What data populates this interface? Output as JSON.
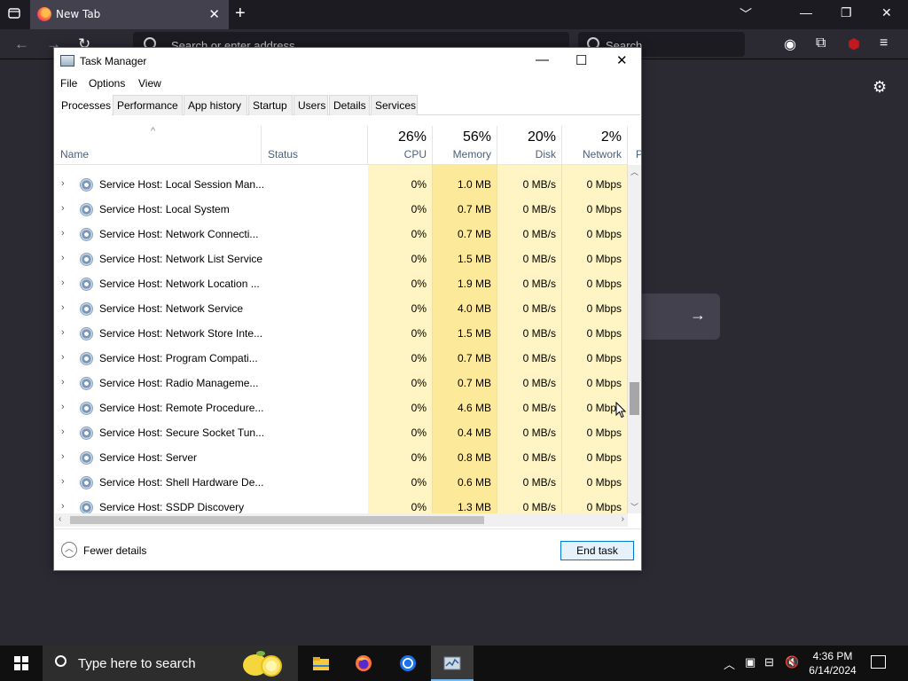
{
  "browser": {
    "tab_title": "New Tab",
    "url_placeholder": "Search or enter address",
    "search_placeholder": "Search"
  },
  "taskmgr": {
    "title": "Task Manager",
    "menu": [
      "File",
      "Options",
      "View"
    ],
    "tabs": [
      "Processes",
      "Performance",
      "App history",
      "Startup",
      "Users",
      "Details",
      "Services"
    ],
    "active_tab": "Processes",
    "columns": {
      "name": "Name",
      "status": "Status",
      "cpu": {
        "pct": "26%",
        "label": "CPU"
      },
      "memory": {
        "pct": "56%",
        "label": "Memory"
      },
      "disk": {
        "pct": "20%",
        "label": "Disk"
      },
      "network": {
        "pct": "2%",
        "label": "Network"
      },
      "power_partial": "P"
    },
    "rows": [
      {
        "name": "Service Host: Local Session Man...",
        "cpu": "0%",
        "memory": "1.0 MB",
        "disk": "0 MB/s",
        "network": "0 Mbps"
      },
      {
        "name": "Service Host: Local System",
        "cpu": "0%",
        "memory": "0.7 MB",
        "disk": "0 MB/s",
        "network": "0 Mbps"
      },
      {
        "name": "Service Host: Network Connecti...",
        "cpu": "0%",
        "memory": "0.7 MB",
        "disk": "0 MB/s",
        "network": "0 Mbps"
      },
      {
        "name": "Service Host: Network List Service",
        "cpu": "0%",
        "memory": "1.5 MB",
        "disk": "0 MB/s",
        "network": "0 Mbps"
      },
      {
        "name": "Service Host: Network Location ...",
        "cpu": "0%",
        "memory": "1.9 MB",
        "disk": "0 MB/s",
        "network": "0 Mbps"
      },
      {
        "name": "Service Host: Network Service",
        "cpu": "0%",
        "memory": "4.0 MB",
        "disk": "0 MB/s",
        "network": "0 Mbps"
      },
      {
        "name": "Service Host: Network Store Inte...",
        "cpu": "0%",
        "memory": "1.5 MB",
        "disk": "0 MB/s",
        "network": "0 Mbps"
      },
      {
        "name": "Service Host: Program Compati...",
        "cpu": "0%",
        "memory": "0.7 MB",
        "disk": "0 MB/s",
        "network": "0 Mbps"
      },
      {
        "name": "Service Host: Radio Manageme...",
        "cpu": "0%",
        "memory": "0.7 MB",
        "disk": "0 MB/s",
        "network": "0 Mbps"
      },
      {
        "name": "Service Host: Remote Procedure...",
        "cpu": "0%",
        "memory": "4.6 MB",
        "disk": "0 MB/s",
        "network": "0 Mbps"
      },
      {
        "name": "Service Host: Secure Socket Tun...",
        "cpu": "0%",
        "memory": "0.4 MB",
        "disk": "0 MB/s",
        "network": "0 Mbps"
      },
      {
        "name": "Service Host: Server",
        "cpu": "0%",
        "memory": "0.8 MB",
        "disk": "0 MB/s",
        "network": "0 Mbps"
      },
      {
        "name": "Service Host: Shell Hardware De...",
        "cpu": "0%",
        "memory": "0.6 MB",
        "disk": "0 MB/s",
        "network": "0 Mbps"
      },
      {
        "name": "Service Host: SSDP Discovery",
        "cpu": "0%",
        "memory": "1.3 MB",
        "disk": "0 MB/s",
        "network": "0 Mbps"
      }
    ],
    "fewer_details": "Fewer details",
    "end_task": "End task"
  },
  "taskbar": {
    "search_placeholder": "Type here to search",
    "apps": [
      "file-explorer",
      "firefox",
      "chrome",
      "task-manager"
    ],
    "time": "4:36 PM",
    "date": "6/14/2024"
  },
  "colors": {
    "cpu_heat": "#fff4c4",
    "mem_heat": "#fde99a",
    "accent": "#0078d7"
  }
}
